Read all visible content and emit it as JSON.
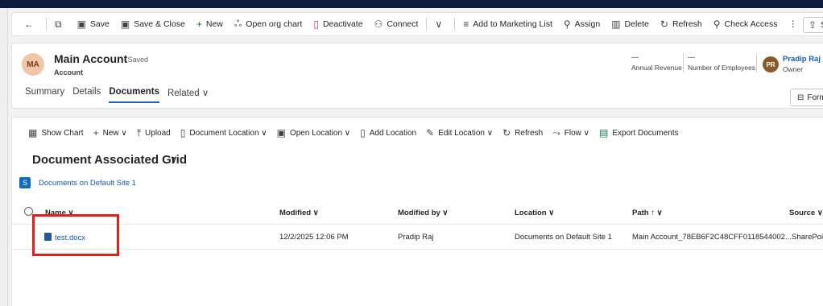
{
  "command_bar": {
    "items": [
      {
        "icon": "back-arrow-icon",
        "label": ""
      },
      {
        "icon": "popout-icon",
        "label": ""
      },
      {
        "icon": "save-icon",
        "label": "Save"
      },
      {
        "icon": "save-close-icon",
        "label": "Save & Close"
      },
      {
        "icon": "plus-icon",
        "label": "New"
      },
      {
        "icon": "org-chart-icon",
        "label": "Open org chart"
      },
      {
        "icon": "deactivate-icon",
        "label": "Deactivate"
      },
      {
        "icon": "connect-icon",
        "label": "Connect"
      },
      {
        "icon": "chevron-down-icon",
        "label": ""
      },
      {
        "icon": "marketing-list-icon",
        "label": "Add to Marketing List"
      },
      {
        "icon": "assign-icon",
        "label": "Assign"
      },
      {
        "icon": "delete-icon",
        "label": "Delete"
      },
      {
        "icon": "refresh-icon",
        "label": "Refresh"
      },
      {
        "icon": "check-access-icon",
        "label": "Check Access"
      },
      {
        "icon": "more-icon",
        "label": "⋮"
      }
    ],
    "share_label": "Sl"
  },
  "record": {
    "initials": "MA",
    "name": "Main Account",
    "saved_status": "- Saved",
    "entity_type": "Account",
    "fields": [
      {
        "value": "---",
        "label": "Annual Revenue"
      },
      {
        "value": "---",
        "label": "Number of Employees"
      }
    ],
    "owner": {
      "initials": "PR",
      "name": "Pradip Raj",
      "role": "Owner"
    },
    "tabs": [
      "Summary",
      "Details",
      "Documents",
      "Related ∨"
    ],
    "active_tab": "Documents",
    "form_button": "Form"
  },
  "subgrid_bar": {
    "items": [
      {
        "icon": "chart-icon",
        "glyph": "▦",
        "label": "Show Chart"
      },
      {
        "icon": "plus-icon",
        "glyph": "+",
        "label": "New ∨"
      },
      {
        "icon": "upload-icon",
        "glyph": "⤒",
        "label": "Upload"
      },
      {
        "icon": "document-location-icon",
        "glyph": "▯",
        "label": "Document Location ∨"
      },
      {
        "icon": "open-location-icon",
        "glyph": "▣",
        "label": "Open Location ∨"
      },
      {
        "icon": "add-location-icon",
        "glyph": "▯",
        "label": "Add Location"
      },
      {
        "icon": "edit-icon",
        "glyph": "✎",
        "label": "Edit Location ∨"
      },
      {
        "icon": "refresh-icon",
        "glyph": "↻",
        "label": "Refresh"
      },
      {
        "icon": "flow-icon",
        "glyph": "⤳",
        "label": "Flow ∨"
      },
      {
        "icon": "excel-icon",
        "glyph": "▤",
        "label": "Export Documents"
      }
    ]
  },
  "grid": {
    "title": "Document Associated Grid",
    "title_chevron": "∨",
    "site_link": "Documents on Default Site 1",
    "columns": [
      "Name ∨",
      "Modified ∨",
      "Modified by ∨",
      "Location ∨",
      "Path ↑ ∨",
      "Source ∨"
    ],
    "rows": [
      {
        "name": "test.docx",
        "modified": "12/2/2025 12:06 PM",
        "modified_by": "Pradip Raj",
        "location": "Documents on Default Site 1",
        "path": "Main Account_78EB6F2C48CFF0118544002...",
        "source": "SharePoi"
      }
    ]
  },
  "colors": {
    "accent": "#0f6cbd",
    "link": "#0f5bbf",
    "highlight": "#e0201f"
  }
}
